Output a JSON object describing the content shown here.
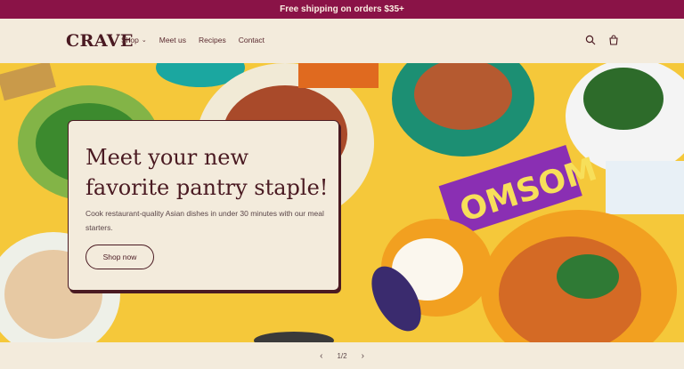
{
  "announcement": "Free shipping on orders $35+",
  "logo": "CRAVE",
  "nav": {
    "shop": "Shop",
    "meet_us": "Meet us",
    "recipes": "Recipes",
    "contact": "Contact"
  },
  "hero": {
    "title": "Meet your new favorite pantry staple!",
    "subtitle": "Cook restaurant-quality Asian dishes in under 30 minutes with our meal starters.",
    "cta": "Shop now",
    "package_text": "OMSOM"
  },
  "pager": {
    "current": "1/2"
  },
  "colors": {
    "brand": "#8a1347",
    "ink": "#4a1a22",
    "cream": "#f3ebdc",
    "hero_bg": "#f5c83a"
  }
}
